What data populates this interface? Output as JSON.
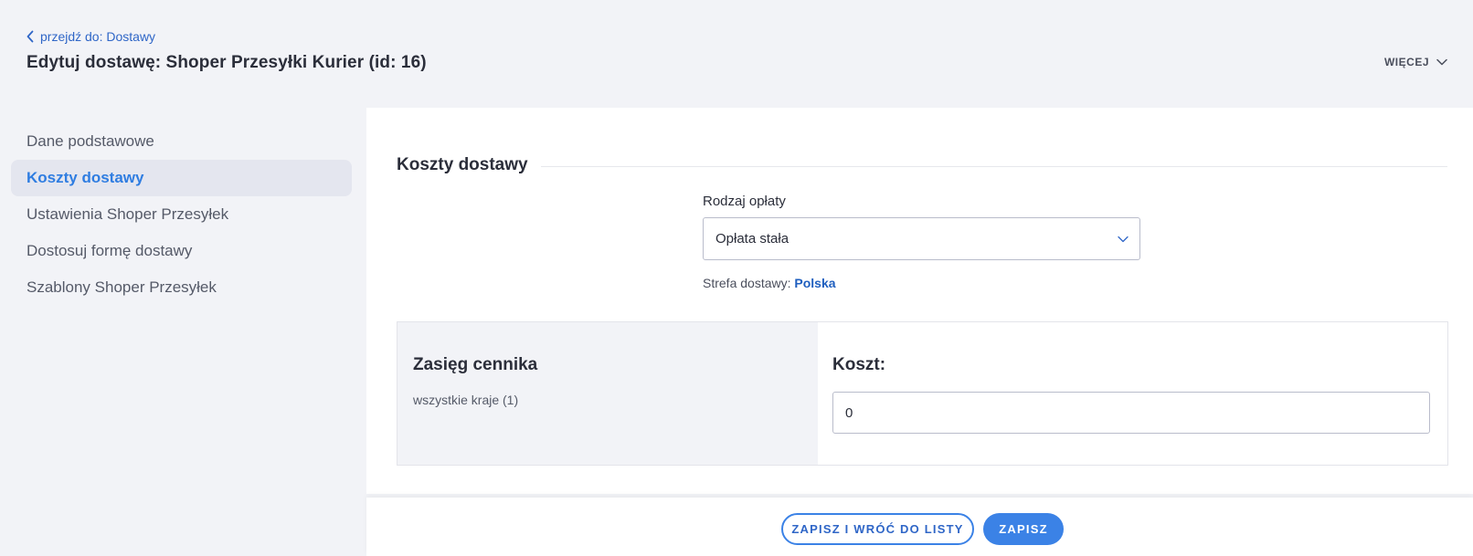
{
  "header": {
    "back_link": "przejdź do: Dostawy",
    "title": "Edytuj dostawę: Shoper Przesyłki Kurier (id: 16)",
    "more_label": "WIĘCEJ"
  },
  "sidebar": {
    "items": [
      {
        "label": "Dane podstawowe"
      },
      {
        "label": "Koszty dostawy"
      },
      {
        "label": "Ustawienia Shoper Przesyłek"
      },
      {
        "label": "Dostosuj formę dostawy"
      },
      {
        "label": "Szablony Shoper Przesyłek"
      }
    ],
    "active_index": 1
  },
  "main": {
    "section_title": "Koszty dostawy",
    "fee_type_label": "Rodzaj opłaty",
    "fee_type_value": "Opłata stała",
    "zone_label": "Strefa dostawy:",
    "zone_value": "Polska",
    "price_range": {
      "title": "Zasięg cennika",
      "subtitle": "wszystkie kraje (1)"
    },
    "cost": {
      "label": "Koszt:",
      "value": "0"
    }
  },
  "footer": {
    "save_and_return_label": "ZAPISZ I WRÓĆ DO LISTY",
    "save_label": "ZAPISZ"
  },
  "colors": {
    "accent": "#3b82e6",
    "background": "#f2f3f7",
    "link": "#2f66c7"
  },
  "icons": {
    "back": "chevron-left-icon",
    "more": "chevron-down-icon",
    "select": "chevron-down-icon"
  }
}
